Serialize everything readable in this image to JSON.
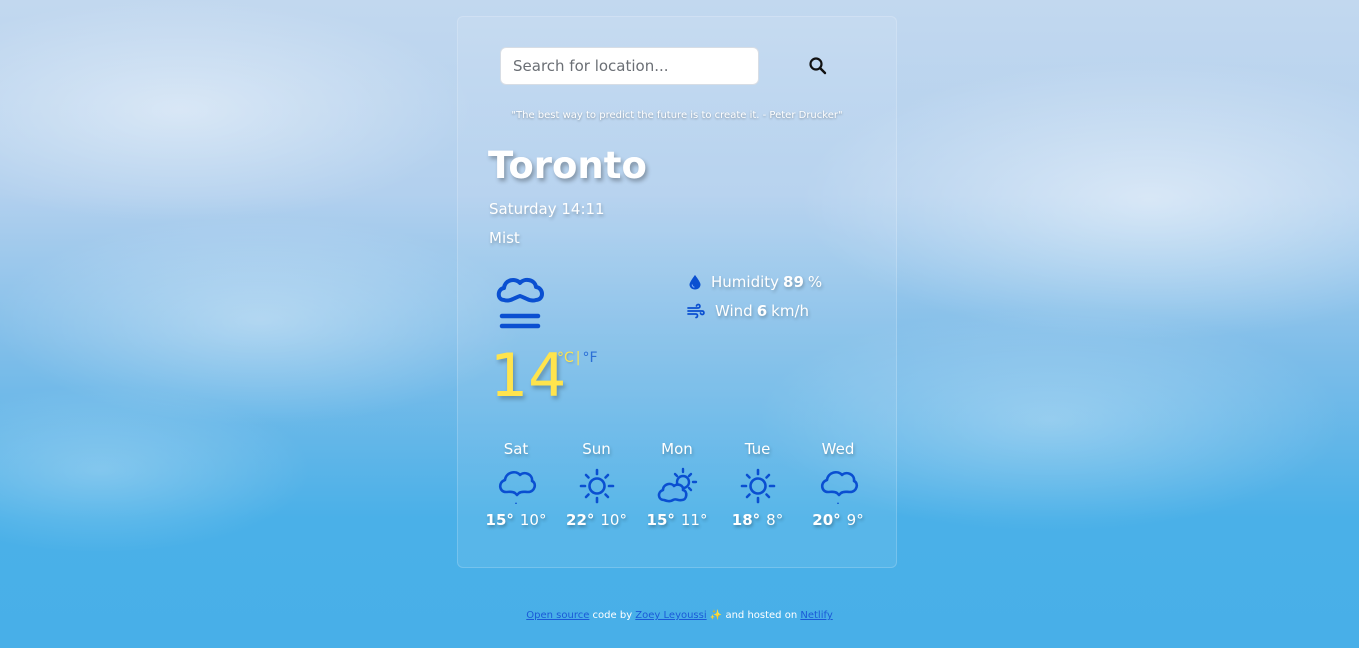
{
  "search": {
    "placeholder": "Search for location...",
    "value": "",
    "icon": "search-icon"
  },
  "quote": "\"The best way to predict the future is to create it. - Peter Drucker\"",
  "current": {
    "city": "Toronto",
    "datetime": "Saturday 14:11",
    "condition": "Mist",
    "icon": "mist-icon",
    "temperature": "14",
    "unit_celsius": "°C",
    "unit_separator": "|",
    "unit_fahrenheit": "°F",
    "humidity_label": "Humidity",
    "humidity_value": "89",
    "humidity_unit": "%",
    "wind_label": "Wind",
    "wind_value": "6",
    "wind_unit": "km/h"
  },
  "forecast": [
    {
      "day": "Sat",
      "icon": "rain-cloud-icon",
      "high": "15°",
      "low": "10°"
    },
    {
      "day": "Sun",
      "icon": "sun-icon",
      "high": "22°",
      "low": "10°"
    },
    {
      "day": "Mon",
      "icon": "partly-cloudy-icon",
      "high": "15°",
      "low": "11°"
    },
    {
      "day": "Tue",
      "icon": "sun-icon",
      "high": "18°",
      "low": "8°"
    },
    {
      "day": "Wed",
      "icon": "rain-cloud-icon",
      "high": "20°",
      "low": "9°"
    }
  ],
  "footer": {
    "link1": "Open source",
    "text1": " code by ",
    "link2": "Zoey Leyoussi",
    "emoji": " ✨ ",
    "text2": "and hosted on ",
    "link3": "Netlify"
  },
  "colors": {
    "icon_blue": "#0a4fd1",
    "temp_yellow": "#ffe44d",
    "link_blue": "#1a5ad7"
  }
}
